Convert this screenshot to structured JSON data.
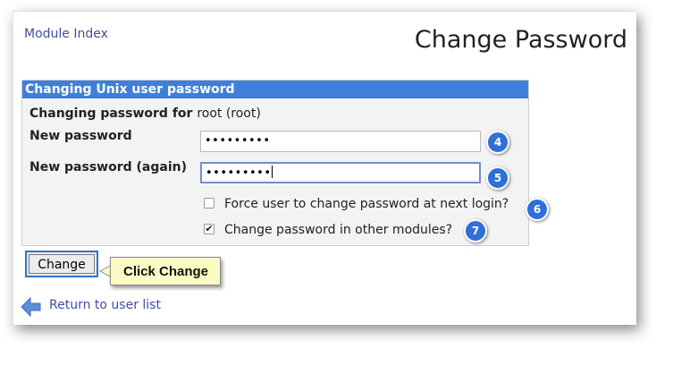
{
  "header": {
    "module_index": "Module Index",
    "title": "Change Password"
  },
  "form": {
    "section_title": "Changing Unix user password",
    "changing_for_label": "Changing password for",
    "changing_for_value": "root (root)",
    "new_password_label": "New password",
    "new_password_value": "•••••••••",
    "new_password_again_label": "New password (again)",
    "new_password_again_value": "•••••••••",
    "force_change_label": "Force user to change password at next login?",
    "force_change_checked": false,
    "other_modules_label": "Change password in other modules?",
    "other_modules_checked": true
  },
  "steps": {
    "step4": "4",
    "step5": "5",
    "step6": "6",
    "step7": "7"
  },
  "actions": {
    "change_label": "Change",
    "callout_text": "Click Change",
    "return_label": "Return to user list"
  },
  "colors": {
    "panel_header": "#3f7fdc",
    "step_badge": "#2f6fd8",
    "link": "#3f4f9f",
    "callout_bg": "#fdfbc4"
  },
  "icons": {
    "return": "arrow-left-icon",
    "checked": "checkmark-icon"
  }
}
